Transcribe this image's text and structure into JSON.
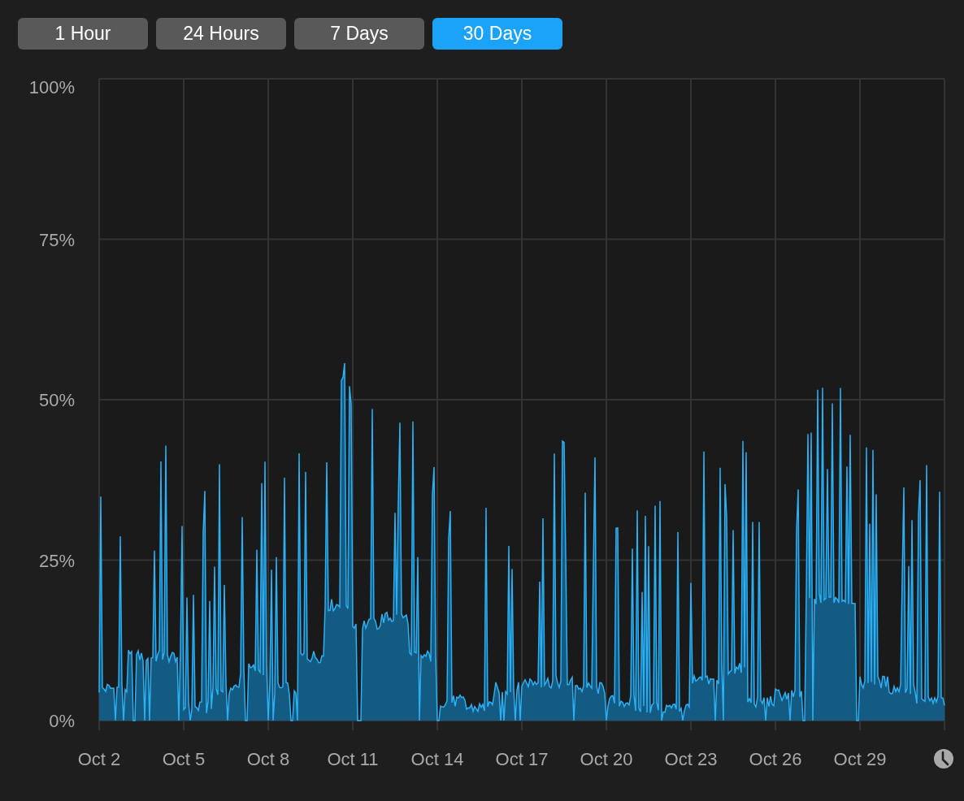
{
  "time_ranges": [
    {
      "label": "1 Hour",
      "selected": false
    },
    {
      "label": "24 Hours",
      "selected": false
    },
    {
      "label": "7 Days",
      "selected": false
    },
    {
      "label": "30 Days",
      "selected": true
    }
  ],
  "chart": {
    "y_labels": [
      "100%",
      "75%",
      "50%",
      "25%",
      "0%"
    ],
    "x_labels": [
      "Oct 2",
      "Oct 5",
      "Oct 8",
      "Oct 11",
      "Oct 14",
      "Oct 17",
      "Oct 20",
      "Oct 23",
      "Oct 26",
      "Oct 29"
    ]
  }
}
